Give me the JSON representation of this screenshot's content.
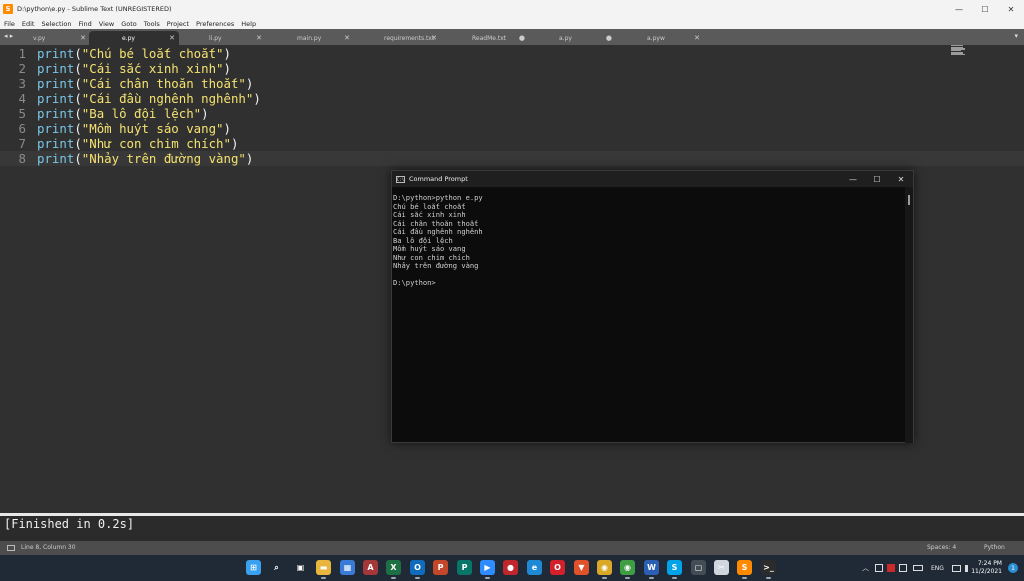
{
  "window": {
    "title": "D:\\python\\e.py - Sublime Text (UNREGISTERED)",
    "controls": {
      "minimize": "—",
      "maximize": "☐",
      "close": "✕"
    }
  },
  "menu": [
    "File",
    "Edit",
    "Selection",
    "Find",
    "View",
    "Goto",
    "Tools",
    "Project",
    "Preferences",
    "Help"
  ],
  "tabs": {
    "nav": "◂ ▸",
    "items": [
      {
        "label": "v.py",
        "close": "✕"
      },
      {
        "label": "e.py",
        "close": "✕",
        "active": true
      },
      {
        "label": "li.py",
        "close": "✕"
      },
      {
        "label": "main.py",
        "close": "✕"
      },
      {
        "label": "requirements.txt",
        "close": "✕"
      },
      {
        "label": "ReadMe.txt",
        "close": "●"
      },
      {
        "label": "a.py",
        "close": "●"
      },
      {
        "label": "a.pyw",
        "close": "✕"
      }
    ],
    "dropdown": "▾"
  },
  "editor": {
    "current_line": 8,
    "lines": [
      {
        "num": "1",
        "fn": "print",
        "open": "(",
        "str": "\"Chú bé loắt choắt\"",
        "close": ")"
      },
      {
        "num": "2",
        "fn": "print",
        "open": "(",
        "str": "\"Cái sắc xinh xinh\"",
        "close": ")"
      },
      {
        "num": "3",
        "fn": "print",
        "open": "(",
        "str": "\"Cái chân thoăn thoắt\"",
        "close": ")"
      },
      {
        "num": "4",
        "fn": "print",
        "open": "(",
        "str": "\"Cái đầu nghênh nghênh\"",
        "close": ")"
      },
      {
        "num": "5",
        "fn": "print",
        "open": "(",
        "str": "\"Ba lô đội lệch\"",
        "close": ")"
      },
      {
        "num": "6",
        "fn": "print",
        "open": "(",
        "str": "\"Mồm huýt sáo vang\"",
        "close": ")"
      },
      {
        "num": "7",
        "fn": "print",
        "open": "(",
        "str": "\"Như con chim chích\"",
        "close": ")"
      },
      {
        "num": "8",
        "fn": "print",
        "open": "(",
        "str": "\"Nhảy trên đường vàng\"",
        "close": ")"
      }
    ]
  },
  "cmd": {
    "icon": "C:\\",
    "title": "Command Prompt",
    "controls": {
      "minimize": "—",
      "maximize": "☐",
      "close": "✕"
    },
    "output": "D:\\python>python e.py\nChú bé loắt choắt\nCái sắc xinh xinh\nCái chân thoăn thoắt\nCái đầu nghênh nghênh\nBa lô đội lệch\nMồm huýt sáo vang\nNhư con chim chích\nNhảy trên đường vàng\n\nD:\\python>"
  },
  "output_panel": {
    "text": "[Finished in 0.2s]"
  },
  "status": {
    "position": "Line 8, Column 30",
    "spaces": "Spaces: 4",
    "syntax": "Python"
  },
  "taskbar": {
    "icons": [
      {
        "name": "windows-start-icon",
        "glyph": "⊞",
        "color": "#3aa0f0"
      },
      {
        "name": "search-icon",
        "glyph": "⌕",
        "color": "#1f2a36"
      },
      {
        "name": "task-view-icon",
        "glyph": "▣",
        "color": "#1f2a36"
      },
      {
        "name": "file-explorer-icon",
        "glyph": "▬",
        "color": "#e8b63c"
      },
      {
        "name": "store-icon",
        "glyph": "▦",
        "color": "#3b7bd8"
      },
      {
        "name": "access-icon",
        "glyph": "A",
        "color": "#a4373a"
      },
      {
        "name": "excel-icon",
        "glyph": "X",
        "color": "#1d7044"
      },
      {
        "name": "outlook-icon",
        "glyph": "O",
        "color": "#0f6cbd"
      },
      {
        "name": "powerpoint-icon",
        "glyph": "P",
        "color": "#c4472c"
      },
      {
        "name": "publisher-icon",
        "glyph": "P",
        "color": "#077568"
      },
      {
        "name": "zoom-icon",
        "glyph": "▶",
        "color": "#2d8cff"
      },
      {
        "name": "record-icon",
        "glyph": "●",
        "color": "#c0272d"
      },
      {
        "name": "edge-icon",
        "glyph": "e",
        "color": "#1e8ad6"
      },
      {
        "name": "opera-icon",
        "glyph": "O",
        "color": "#d4202a"
      },
      {
        "name": "brave-icon",
        "glyph": "▼",
        "color": "#e0522a"
      },
      {
        "name": "chrome-icon",
        "glyph": "◉",
        "color": "#d9a826"
      },
      {
        "name": "chrome-beta-icon",
        "glyph": "◉",
        "color": "#3f9e44"
      },
      {
        "name": "word-icon",
        "glyph": "W",
        "color": "#2b5fb4"
      },
      {
        "name": "skype-icon",
        "glyph": "S",
        "color": "#00a2e8"
      },
      {
        "name": "device-icon",
        "glyph": "▢",
        "color": "#444c55"
      },
      {
        "name": "snipping-icon",
        "glyph": "✂",
        "color": "#cfd6de"
      },
      {
        "name": "sublime-icon",
        "glyph": "S",
        "color": "#ff8a00"
      },
      {
        "name": "terminal-icon",
        "glyph": ">_",
        "color": "#2c2c2c"
      }
    ],
    "tray": {
      "chevron": "︿",
      "lang": "ENG"
    },
    "time": "7:24 PM",
    "date": "11/2/2021",
    "notifications": "1"
  }
}
